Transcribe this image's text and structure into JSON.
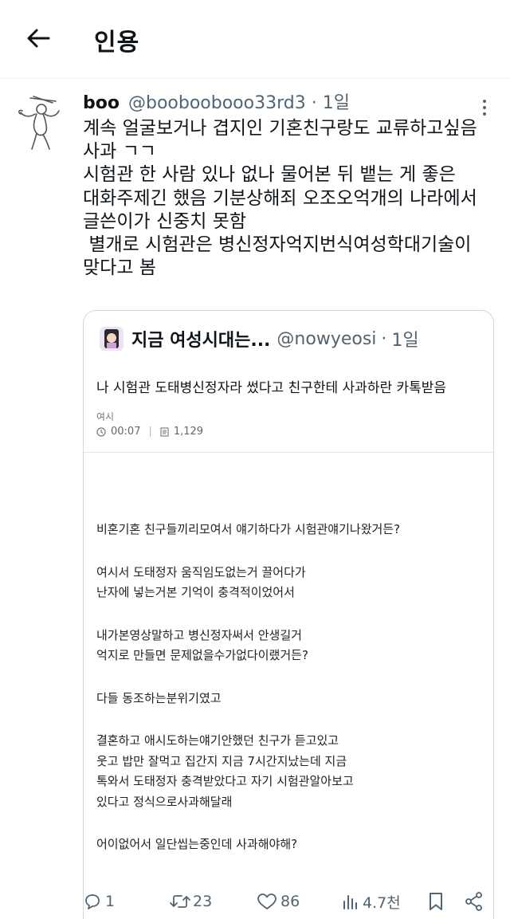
{
  "header": {
    "title": "인용"
  },
  "post": {
    "name": "boo",
    "handle": "@booboobooo33rd3",
    "dot": "·",
    "time": "1일",
    "lines": [
      "계속 얼굴보거나 겹지인 기혼친구랑도 교류하고싶음",
      "사과 ㄱㄱ",
      "시험관 한 사람 있나 없나 물어본 뒤 뱉는 게 좋은",
      "대화주제긴 했음 기분상해죄 오조오억개의 나라에서",
      "글쓴이가 신중치 못함",
      " 별개로 시험관은 병신정자억지번식여성학대기술이",
      "맞다고 봄"
    ]
  },
  "quote": {
    "name": "지금 여성시대는...",
    "handle": "@nowyeosi",
    "dot": "·",
    "time": "1일",
    "inner_title": "나 시험관 도태병신정자라 썼다고 친구한테 사과하란 카톡받음",
    "inner_sub": "여시",
    "inner_time": "00:07",
    "inner_views": "1,129",
    "paragraphs": [
      [
        "비혼기혼 친구들끼리모여서 얘기하다가 시험관얘기나왔거든?"
      ],
      [
        "여시서 도태정자 움직임도없는거 끌어다가",
        "난자에 넣는거본 기억이 충격적이었어서"
      ],
      [
        "내가본영상말하고 병신정자써서 안생길거",
        "억지로 만들면 문제없을수가없다이랬거든?"
      ],
      [
        "다들 동조하는분위기였고"
      ],
      [
        "결혼하고 애시도하는얘기안했던 친구가 듣고있고",
        "웃고 밥만 잘먹고 집간지 지금 7시간지났는데 지금",
        "톡와서 도태정자 충격받았다고 자기 시험관알아보고",
        "있다고 정식으로사과해달래"
      ],
      [
        "어이없어서 일단씹는중인데 사과해야해?"
      ]
    ]
  },
  "actions": {
    "reply_count": "1",
    "retweet_count": "23",
    "like_count": "86",
    "views_count": "4.7천"
  },
  "colors": {
    "text": "#0f1419",
    "secondary": "#536471",
    "border": "#cfd9de"
  }
}
